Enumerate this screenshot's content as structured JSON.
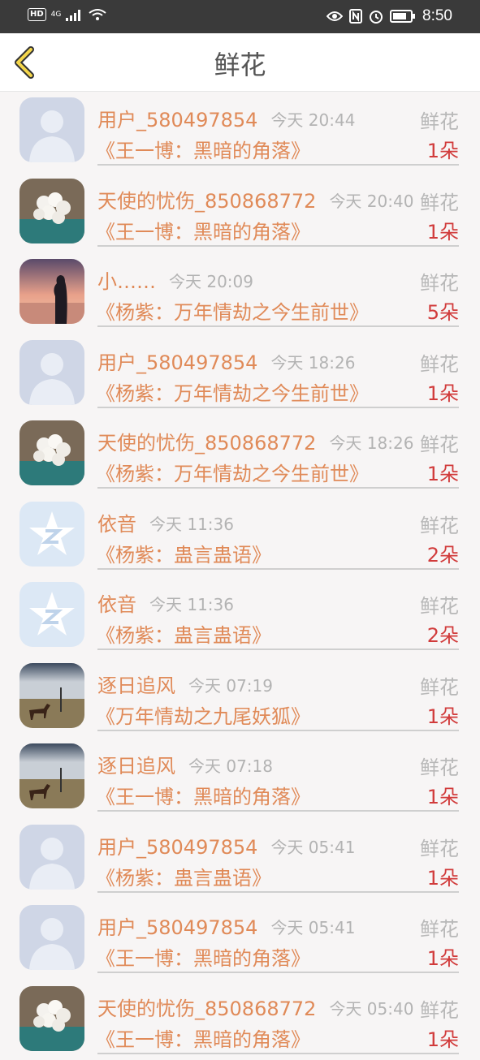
{
  "status": {
    "hd": "HD",
    "net": "4G",
    "time": "8:50"
  },
  "header": {
    "title": "鲜花"
  },
  "items": [
    {
      "name": "用户_580497854",
      "time": "今天 20:44",
      "type": "鲜花",
      "book": "《王一博：黑暗的角落》",
      "count": "1朵",
      "avatar": "default"
    },
    {
      "name": "天使的忧伤_850868772",
      "time": "今天 20:40",
      "type": "鲜花",
      "book": "《王一博：黑暗的角落》",
      "count": "1朵",
      "avatar": "flowers"
    },
    {
      "name": "小……",
      "time": "今天 20:09",
      "type": "鲜花",
      "book": "《杨紫：万年情劫之今生前世》",
      "count": "5朵",
      "avatar": "sunset"
    },
    {
      "name": "用户_580497854",
      "time": "今天 18:26",
      "type": "鲜花",
      "book": "《杨紫：万年情劫之今生前世》",
      "count": "1朵",
      "avatar": "default"
    },
    {
      "name": "天使的忧伤_850868772",
      "time": "今天 18:26",
      "type": "鲜花",
      "book": "《杨紫：万年情劫之今生前世》",
      "count": "1朵",
      "avatar": "flowers"
    },
    {
      "name": "依音",
      "time": "今天 11:36",
      "type": "鲜花",
      "book": "《杨紫：蛊言蛊语》",
      "count": "2朵",
      "avatar": "qq"
    },
    {
      "name": "依音",
      "time": "今天 11:36",
      "type": "鲜花",
      "book": "《杨紫：蛊言蛊语》",
      "count": "2朵",
      "avatar": "qq"
    },
    {
      "name": "逐日追风",
      "time": "今天 07:19",
      "type": "鲜花",
      "book": "《万年情劫之九尾妖狐》",
      "count": "1朵",
      "avatar": "horse"
    },
    {
      "name": "逐日追风",
      "time": "今天 07:18",
      "type": "鲜花",
      "book": "《王一博：黑暗的角落》",
      "count": "1朵",
      "avatar": "horse"
    },
    {
      "name": "用户_580497854",
      "time": "今天 05:41",
      "type": "鲜花",
      "book": "《杨紫：蛊言蛊语》",
      "count": "1朵",
      "avatar": "default"
    },
    {
      "name": "用户_580497854",
      "time": "今天 05:41",
      "type": "鲜花",
      "book": "《王一博：黑暗的角落》",
      "count": "1朵",
      "avatar": "default"
    },
    {
      "name": "天使的忧伤_850868772",
      "time": "今天 05:40",
      "type": "鲜花",
      "book": "《王一博：黑暗的角落》",
      "count": "1朵",
      "avatar": "flowers"
    }
  ]
}
